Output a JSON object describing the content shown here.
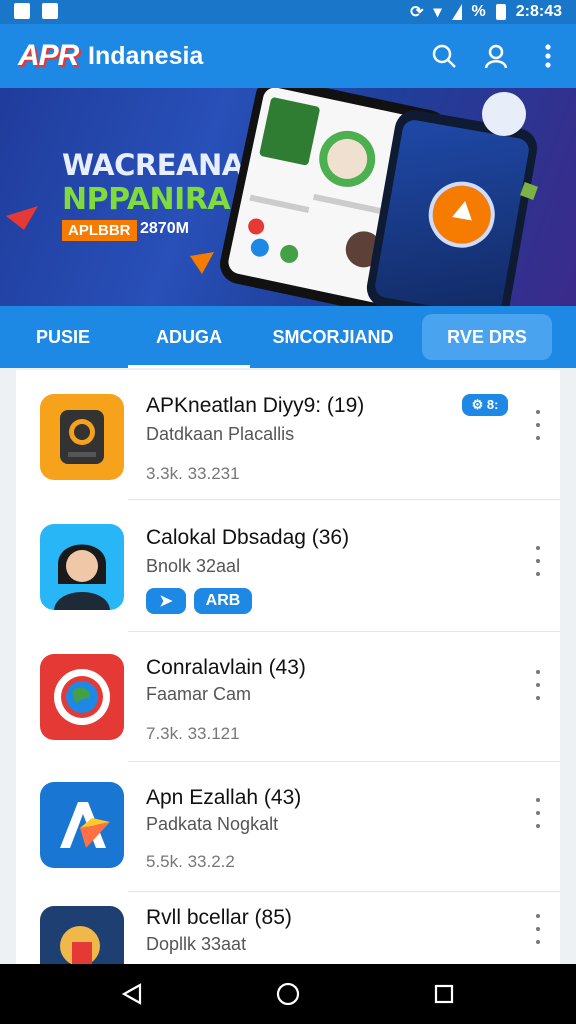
{
  "status": {
    "time": "2:8:43",
    "network": "%"
  },
  "appbar": {
    "title": "Indanesia",
    "logo": "APR"
  },
  "banner": {
    "line1": "WACREANAR",
    "line2": "NPPANIRA",
    "chip": "APLBBR",
    "subtitle": "2870M"
  },
  "tabs": [
    {
      "label": "PUSIE"
    },
    {
      "label": "ADUGA"
    },
    {
      "label": "SMCORJIAND"
    },
    {
      "label": "RVE DRS"
    }
  ],
  "items": [
    {
      "title": "APKneatlan Diyy9: (19)",
      "subtitle": "Datdkaan Placallis",
      "meta": "3.3k. 33.231",
      "badge": "⚙ 8:",
      "icon": "camera-app-icon"
    },
    {
      "title": "Calokal Dbsadag (36)",
      "subtitle": "Bnolk 32aal",
      "meta": "",
      "badges": [
        "➤",
        "ARB"
      ],
      "icon": "avatar-app-icon"
    },
    {
      "title": "Conralavlain (43)",
      "subtitle": "Faamar Cam",
      "meta": "7.3k. 33.121",
      "icon": "globe-app-icon"
    },
    {
      "title": "Apn Ezallah (43)",
      "subtitle": "Padkata Nogkalt",
      "meta": "5.5k. 33.2.2",
      "icon": "arrow-app-icon"
    },
    {
      "title": "Rvll bcellar (85)",
      "subtitle": "Dopllk 33aat",
      "meta": "",
      "icon": "game-app-icon"
    }
  ],
  "colors": {
    "primary": "#1e88e5",
    "statusbar": "#1976c8",
    "accent": "#f57c00"
  }
}
